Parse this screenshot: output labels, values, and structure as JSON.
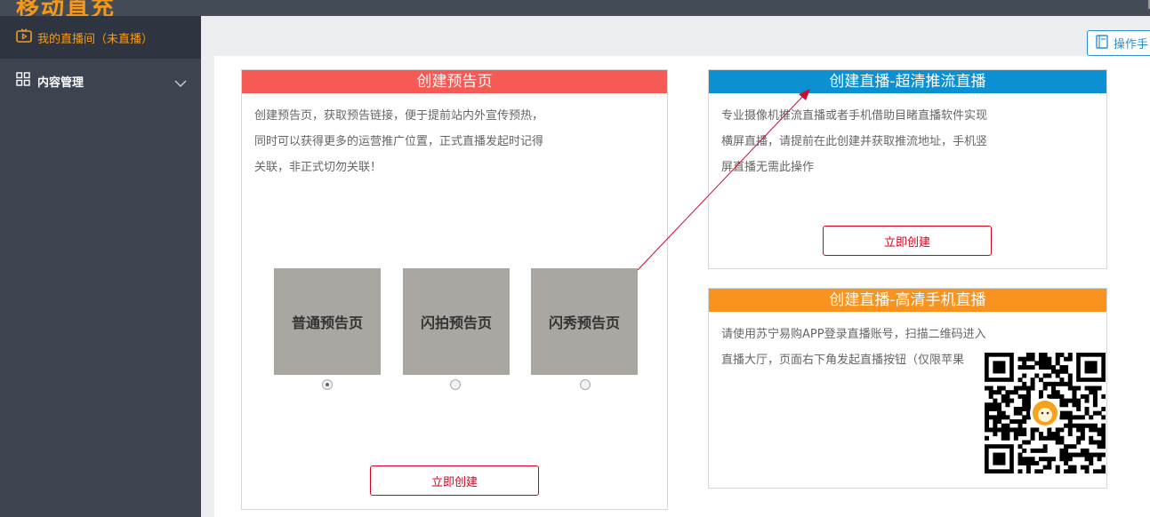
{
  "header": {
    "brand": "移动直充"
  },
  "sidebar": {
    "items": [
      {
        "label": "我的直播间（未直播）",
        "active": true,
        "icon": "tv-icon"
      },
      {
        "label": "内容管理",
        "active": false,
        "icon": "grid-icon"
      }
    ]
  },
  "toolbar": {
    "guide_label": "操作手"
  },
  "cards": {
    "preview": {
      "title": "创建预告页",
      "desc_lines": [
        "创建预告页，获取预告链接，便于提前站内外宣传预热，",
        "同时可以获得更多的运营推广位置，正式直播发起时记得",
        "关联，非正式切勿关联！"
      ],
      "options": [
        {
          "label": "普通预告页",
          "selected": true
        },
        {
          "label": "闪拍预告页",
          "selected": false
        },
        {
          "label": "闪秀预告页",
          "selected": false
        }
      ],
      "button": "立即创建"
    },
    "hd_push": {
      "title": "创建直播-超清推流直播",
      "desc_lines": [
        "专业摄像机推流直播或者手机借助目睹直播软件实现",
        "横屏直播，请提前在此创建并获取推流地址，手机竖",
        "屏直播无需此操作"
      ],
      "button": "立即创建"
    },
    "mobile": {
      "title": "创建直播-高清手机直播",
      "desc_lines": [
        "请使用苏宁易购APP登录直播账号，扫描二维码进入",
        "直播大厅，页面右下角发起直播按钮（仅限苹果"
      ]
    }
  },
  "colors": {
    "accent_orange": "#f39a1e",
    "preview_red": "#f55a55",
    "hd_blue": "#0d90d2",
    "mobile_orange": "#f7931e",
    "create_red": "#d6001c"
  }
}
